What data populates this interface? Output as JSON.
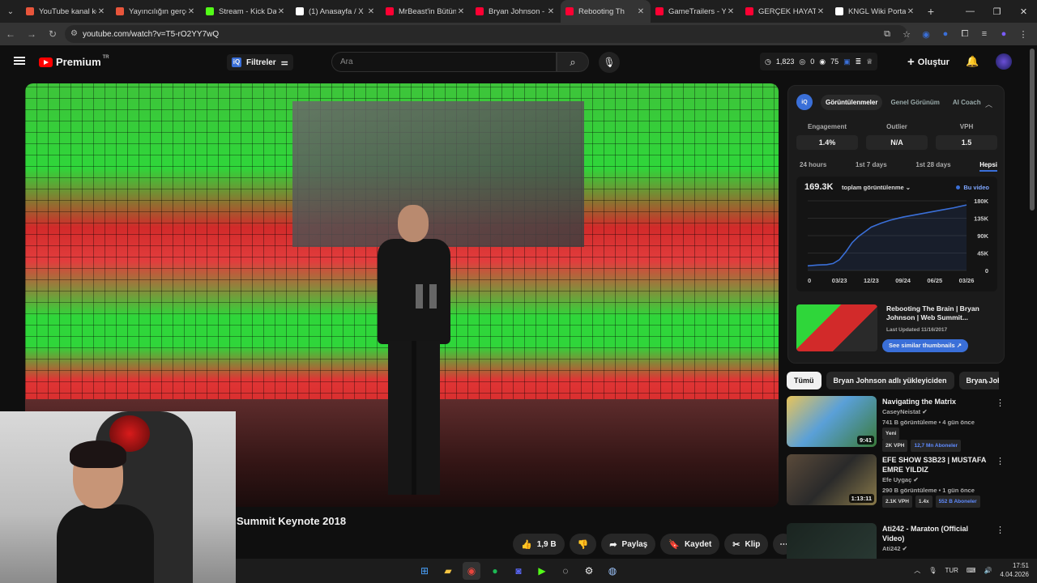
{
  "browser": {
    "tabs": [
      {
        "title": "YouTube kanal ko",
        "favicon_color": "#e8553b"
      },
      {
        "title": "Yayıncılığın gerçe",
        "favicon_color": "#e8553b"
      },
      {
        "title": "Stream - Kick Das",
        "favicon_color": "#53fc18"
      },
      {
        "title": "(1) Anasayfa / X",
        "favicon_color": "#ffffff"
      },
      {
        "title": "MrBeast'in Bütün",
        "favicon_color": "#ff0033"
      },
      {
        "title": "Bryan Johnson - Y",
        "favicon_color": "#ff0033"
      },
      {
        "title": "Rebooting Th",
        "favicon_color": "#ff0033",
        "active": true
      },
      {
        "title": "GameTrailers - Yo",
        "favicon_color": "#ff0033"
      },
      {
        "title": "GERÇEK HAYATTA",
        "favicon_color": "#ff0033"
      },
      {
        "title": "KNGL Wiki Portal",
        "favicon_color": "#ffffff"
      }
    ],
    "url": "youtube.com/watch?v=T5-rO2YY7wQ"
  },
  "youtube": {
    "logo_text": "Premium",
    "logo_region": "TR",
    "filters_label": "Filtreler",
    "search_placeholder": "Ara",
    "header_stats": {
      "views": "1,823",
      "a": "0",
      "b": "75"
    },
    "create_label": "Oluştur",
    "video_title": "Summit Keynote 2018",
    "actions": {
      "like_count": "1,9 B",
      "share": "Paylaş",
      "save": "Kaydet",
      "clip": "Klip"
    }
  },
  "vidiq": {
    "tabs": [
      "Görüntülenmeler",
      "Genel Görünüm",
      "AI Coach"
    ],
    "active_tab": 0,
    "metrics": [
      {
        "label": "Engagement",
        "value": "1.4%"
      },
      {
        "label": "Outlier",
        "value": "N/A"
      },
      {
        "label": "VPH",
        "value": "1.5"
      }
    ],
    "ranges": [
      "24 hours",
      "1st 7 days",
      "1st 28 days",
      "Hepsi"
    ],
    "active_range": 3,
    "total_views": "169.3K",
    "views_dropdown": "toplam görüntülenme",
    "legend": "Bu video",
    "similar": {
      "title": "Rebooting The Brain | Bryan Johnson | Web Summit...",
      "updated": "Last Updated 11/16/2017",
      "button": "See similar thumbnails"
    }
  },
  "chart_data": {
    "type": "line",
    "title": "",
    "xlabel": "",
    "ylabel": "",
    "x_ticks": [
      "0",
      "03/23",
      "12/23",
      "09/24",
      "06/25",
      "03/26"
    ],
    "y_ticks": [
      "0",
      "45K",
      "90K",
      "135K",
      "180K"
    ],
    "ylim": [
      0,
      180000
    ],
    "series": [
      {
        "name": "Bu video",
        "color": "#3a6fd8",
        "x": [
          0,
          0.3,
          0.6,
          0.8,
          1.0,
          1.2,
          1.4,
          1.6,
          1.8,
          2.0,
          2.3,
          2.6,
          3.0,
          3.4,
          3.8,
          4.2,
          4.6,
          5.0
        ],
        "values": [
          12000,
          14000,
          15000,
          18000,
          28000,
          48000,
          72000,
          88000,
          100000,
          112000,
          122000,
          130000,
          138000,
          144000,
          150000,
          156000,
          162000,
          169300
        ]
      }
    ]
  },
  "chips": [
    "Tümü",
    "Bryan Johnson adlı yükleyiciden",
    "Bryan Johnson"
  ],
  "recommendations": [
    {
      "title": "Navigating the Matrix",
      "channel": "CaseyNeistat",
      "meta": "741 B görüntüleme • 4 gün önce",
      "new": "Yeni",
      "vph": "2K VPH",
      "extra": "",
      "subs": "12,7 Mn Aboneler",
      "duration": "9:41"
    },
    {
      "title": "EFE SHOW S3B23 | MUSTAFA EMRE YILDIZ",
      "channel": "Efe Uygaç",
      "meta": "290 B görüntüleme • 1 gün önce",
      "new": "",
      "vph": "2.1K VPH",
      "extra": "1.4x",
      "subs": "552 B Aboneler",
      "duration": "1:13:11"
    },
    {
      "title": "Ati242 - Maraton (Official Video)",
      "channel": "Ati242",
      "meta": "",
      "new": "",
      "vph": "",
      "extra": "",
      "subs": "",
      "duration": ""
    }
  ],
  "taskbar": {
    "lang": "TUR",
    "time": "17:51",
    "date": "4.04.2026"
  },
  "colors": {
    "accent": "#3a6fd8",
    "youtube_red": "#ff0000"
  }
}
